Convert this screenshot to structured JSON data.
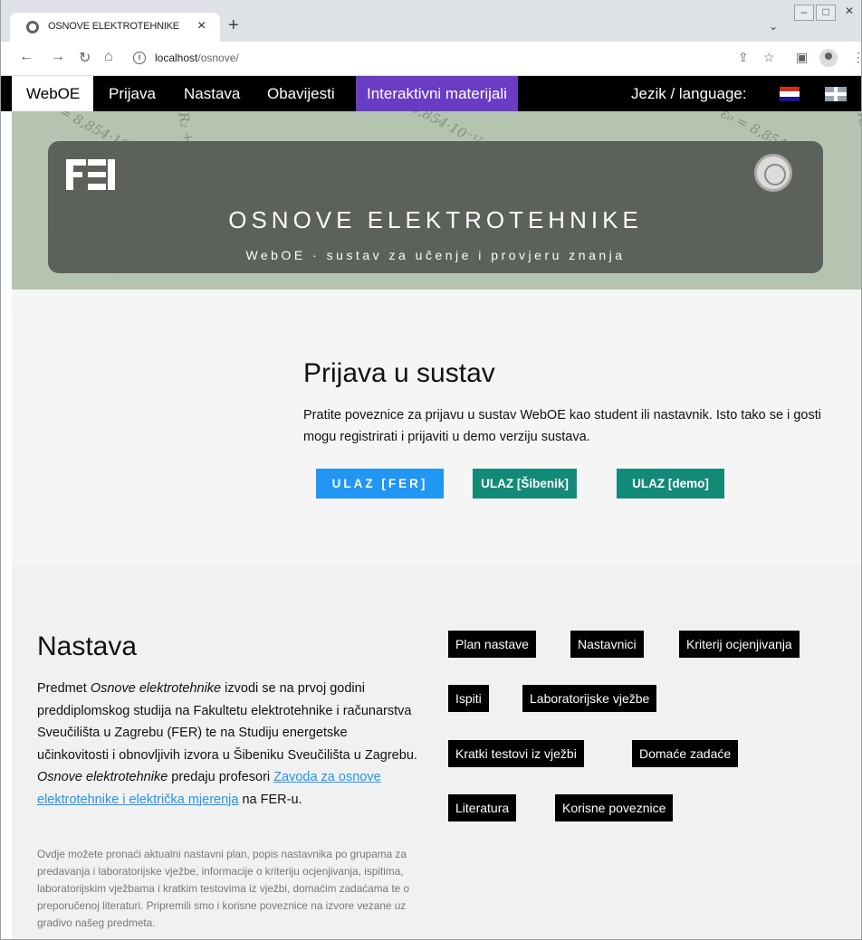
{
  "browser": {
    "tab_title": "OSNOVE ELEKTROTEHNIKE",
    "tab_close": "×",
    "new_tab": "+",
    "url_host": "localhost",
    "url_path": "/osnove/"
  },
  "nav": {
    "brand": "WebOE",
    "items": [
      {
        "label": "Prijava"
      },
      {
        "label": "Nastava"
      },
      {
        "label": "Obavijesti"
      },
      {
        "label": "Interaktivni materijali"
      }
    ],
    "language": "Jezik / language:"
  },
  "hero": {
    "title": "OSNOVE ELEKTROTEHNIKE",
    "subtitle": "WebOE · sustav za učenje i provjeru znanja"
  },
  "login": {
    "heading": "Prijava u sustav",
    "text": "Pratite poveznice za prijavu u sustav WebOE kao student ili nastavnik. Isto tako se i gosti mogu registrirati i prijaviti u demo verziju sustava.",
    "buttons": {
      "fer": "ULAZ [FER]",
      "sibenik": "ULAZ [Šibenik]",
      "demo": "ULAZ [demo]"
    }
  },
  "nastava": {
    "heading": "Nastava",
    "lead_1": "Predmet ",
    "lead_em1": "Osnove elektrotehnike",
    "lead_2": " izvodi se na prvoj godini preddiplomskog studija na Fakultetu elektrotehnike i računarstva Sveučilišta u Zagrebu (FER) te na Studiju energetske učinkovitosti i obnovljivih izvora u Šibeniku Sveučilišta u Zagrebu. ",
    "lead_em2": "Osnove elektrotehnike",
    "lead_3": " predaju profesori ",
    "lead_link": "Zavoda za osnove elektrotehnike i električka mjerenja",
    "lead_4": " na FER-u.",
    "small": "Ovdje možete pronaći aktualni nastavni plan, popis nastavnika po grupama za predavanja i laboratorijske vježbe, informacije o kriteriju ocjenjivanja, ispitima, laboratorijskim vježbama i kratkim testovima iz vježbi, domaćim zadaćama te o preporučenoj literaturi. Pripremili smo i korisne poveznice na izvore vezane uz gradivo našeg predmeta.",
    "tags": {
      "plan": "Plan nastave",
      "nastavnici": "Nastavnici",
      "kriterij": "Kriterij ocjenjivanja",
      "ispiti": "Ispiti",
      "lab": "Laboratorijske vježbe",
      "testovi": "Kratki testovi iz vježbi",
      "zadace": "Domaće zadaće",
      "literatura": "Literatura",
      "poveznice": "Korisne poveznice"
    }
  },
  "colors": {
    "nav_active": "#6a3cc4",
    "button_blue": "#2196f3",
    "button_teal": "#138a78"
  }
}
